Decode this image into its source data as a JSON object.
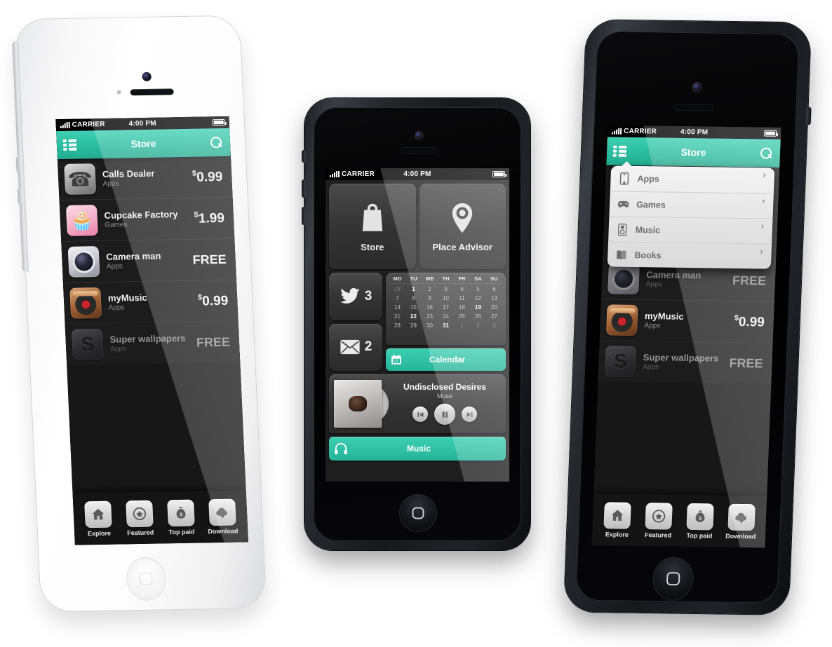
{
  "status_bar": {
    "carrier": "CARRIER",
    "time": "4:00 PM"
  },
  "store": {
    "title": "Store",
    "menu_icon": "list-icon",
    "search_icon": "search-icon",
    "apps": [
      {
        "name": "Calls Dealer",
        "category": "Apps",
        "price": "0.99",
        "currency": "$",
        "free": false,
        "icon": "vintage-telephone-icon"
      },
      {
        "name": "Cupcake Factory",
        "category": "Games",
        "price": "1.99",
        "currency": "$",
        "free": false,
        "icon": "cupcake-icon"
      },
      {
        "name": "Camera man",
        "category": "Apps",
        "price": "FREE",
        "currency": "",
        "free": true,
        "icon": "camera-lens-icon"
      },
      {
        "name": "myMusic",
        "category": "Apps",
        "price": "0.99",
        "currency": "$",
        "free": false,
        "icon": "turntable-icon"
      },
      {
        "name": "Super wallpapers",
        "category": "Apps",
        "price": "FREE",
        "currency": "",
        "free": true,
        "icon": "wallpaper-s-icon"
      }
    ],
    "tabs": [
      {
        "label": "Explore",
        "icon": "home-icon"
      },
      {
        "label": "Featured",
        "icon": "star-badge-icon"
      },
      {
        "label": "Top paid",
        "icon": "money-bag-icon"
      },
      {
        "label": "Download",
        "icon": "cloud-download-icon"
      }
    ],
    "dropdown": [
      {
        "label": "Apps",
        "icon": "phone-device-icon",
        "chevron": "›"
      },
      {
        "label": "Games",
        "icon": "gamepad-icon",
        "chevron": "›"
      },
      {
        "label": "Music",
        "icon": "speaker-icon",
        "chevron": "›"
      },
      {
        "label": "Books",
        "icon": "book-icon",
        "chevron": "›"
      }
    ]
  },
  "dashboard": {
    "tiles": [
      {
        "label": "Store",
        "icon": "shopping-bag-icon"
      },
      {
        "label": "Place Advisor",
        "icon": "map-pin-icon"
      }
    ],
    "twitter": {
      "count": "3",
      "icon": "twitter-bird-icon"
    },
    "mail": {
      "count": "2",
      "icon": "envelope-icon"
    },
    "calendar": {
      "button_label": "Calendar",
      "button_icon": "calendar-icon",
      "weekdays": [
        "MO",
        "TU",
        "WE",
        "TH",
        "FR",
        "SA",
        "SU"
      ],
      "weeks": [
        [
          {
            "d": "28",
            "s": "dim"
          },
          {
            "d": "1",
            "s": "on"
          },
          {
            "d": "2",
            "s": ""
          },
          {
            "d": "3",
            "s": ""
          },
          {
            "d": "4",
            "s": ""
          },
          {
            "d": "5",
            "s": ""
          },
          {
            "d": "6",
            "s": ""
          }
        ],
        [
          {
            "d": "7",
            "s": ""
          },
          {
            "d": "8",
            "s": ""
          },
          {
            "d": "9",
            "s": ""
          },
          {
            "d": "10",
            "s": ""
          },
          {
            "d": "11",
            "s": ""
          },
          {
            "d": "12",
            "s": ""
          },
          {
            "d": "13",
            "s": ""
          }
        ],
        [
          {
            "d": "14",
            "s": ""
          },
          {
            "d": "15",
            "s": ""
          },
          {
            "d": "16",
            "s": ""
          },
          {
            "d": "17",
            "s": ""
          },
          {
            "d": "18",
            "s": ""
          },
          {
            "d": "19",
            "s": "on"
          },
          {
            "d": "20",
            "s": ""
          }
        ],
        [
          {
            "d": "21",
            "s": ""
          },
          {
            "d": "22",
            "s": "on"
          },
          {
            "d": "23",
            "s": ""
          },
          {
            "d": "24",
            "s": ""
          },
          {
            "d": "25",
            "s": ""
          },
          {
            "d": "26",
            "s": ""
          },
          {
            "d": "27",
            "s": ""
          }
        ],
        [
          {
            "d": "28",
            "s": ""
          },
          {
            "d": "29",
            "s": ""
          },
          {
            "d": "30",
            "s": ""
          },
          {
            "d": "31",
            "s": "on"
          },
          {
            "d": "1",
            "s": "dim"
          },
          {
            "d": "2",
            "s": "dim"
          },
          {
            "d": "3",
            "s": "dim"
          }
        ]
      ]
    },
    "player": {
      "track": "Undisclosed Desires",
      "artist": "Muse",
      "prev_icon": "skip-back-icon",
      "play_icon": "pause-icon",
      "next_icon": "skip-forward-icon",
      "button_label": "Music",
      "button_icon": "headphones-icon"
    }
  },
  "colors": {
    "accent": "#2BBD9F",
    "accent_light": "#3FD0B4",
    "screen_bg": "#1C1C1C"
  }
}
